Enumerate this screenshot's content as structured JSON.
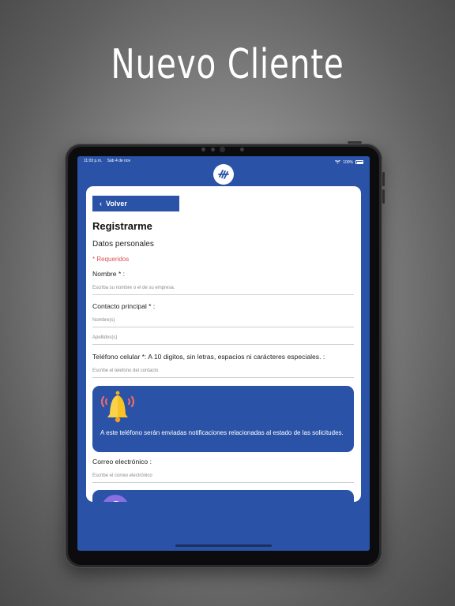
{
  "banner": {
    "title": "Nuevo Cliente"
  },
  "status_bar": {
    "time": "11:03 p.m.",
    "date": "Sáb 4 de nov",
    "battery": "100%",
    "wifi_icon": "wifi-icon",
    "battery_icon": "battery-icon"
  },
  "form": {
    "back_label": "Volver",
    "title": "Registrarme",
    "section": "Datos personales",
    "required_note": "* Requeridos",
    "name": {
      "label": "Nombre * :",
      "placeholder": "Escriba su nombre o el de su empresa."
    },
    "contact": {
      "label": "Contacto principal * :",
      "first_placeholder": "Nombre(s)",
      "last_placeholder": "Apellidos(s)"
    },
    "phone": {
      "label": "Teléfono celular *: A 10 digitos, sin letras, espacios ni carácteres especiales. :",
      "placeholder": "Escribe el telefono del contacto"
    },
    "notice": {
      "icon": "bell-icon",
      "text": "A este teléfono serán enviadas notificaciones relacionadas al estado de las solicitudes."
    },
    "email": {
      "label": "Correo electrónico :",
      "placeholder": "Escribe el correo electrónico"
    }
  },
  "colors": {
    "brand_blue": "#2a53a7",
    "required_red": "#d9534f",
    "bell_yellow": "#f7c325"
  }
}
